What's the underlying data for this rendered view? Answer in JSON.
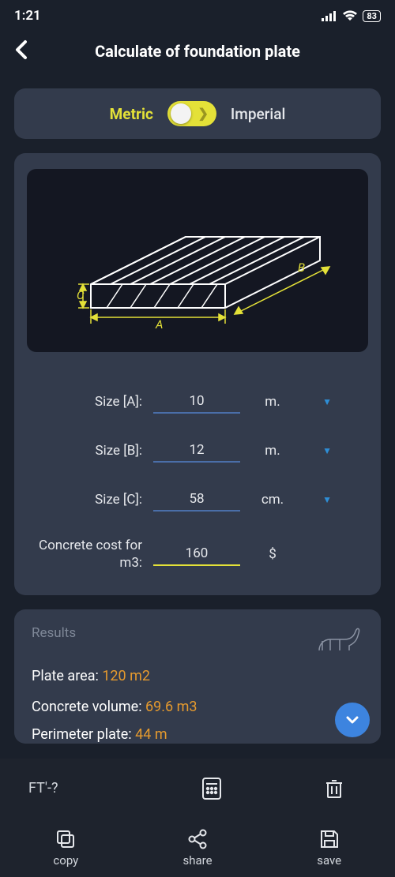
{
  "status": {
    "time": "1:21",
    "battery": "83"
  },
  "header": {
    "title": "Calculate of foundation plate"
  },
  "units": {
    "metric_label": "Metric",
    "imperial_label": "Imperial",
    "selected": "metric"
  },
  "diagram": {
    "labels": {
      "a": "A",
      "b": "B",
      "c": "C"
    }
  },
  "form": {
    "rows": [
      {
        "label": "Size [A]:",
        "value": "10",
        "unit": "m.",
        "has_dropdown": true,
        "accent": false
      },
      {
        "label": "Size [B]:",
        "value": "12",
        "unit": "m.",
        "has_dropdown": true,
        "accent": false
      },
      {
        "label": "Size [C]:",
        "value": "58",
        "unit": "cm.",
        "has_dropdown": true,
        "accent": false
      },
      {
        "label": "Concrete cost for m3:",
        "value": "160",
        "unit": "$",
        "has_dropdown": false,
        "accent": true
      }
    ]
  },
  "results": {
    "heading": "Results",
    "lines": [
      {
        "label": "Plate area: ",
        "value": "120 m2"
      },
      {
        "label": "Concrete volume: ",
        "value": "69.6 m3"
      },
      {
        "label": "Perimeter plate: ",
        "value": "44 m"
      }
    ]
  },
  "bottom": {
    "top_left": "FT'-?",
    "copy": "copy",
    "share": "share",
    "save": "save"
  }
}
